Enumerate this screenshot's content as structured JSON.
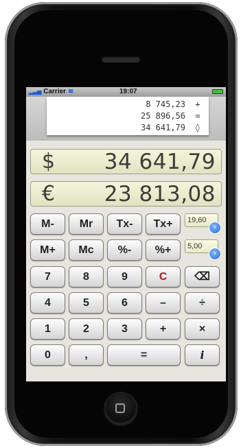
{
  "status": {
    "carrier": "Carrier",
    "time": "19:07"
  },
  "tape": [
    {
      "value": "8 745,23",
      "op": "+"
    },
    {
      "value": "25 896,56",
      "op": "="
    },
    {
      "value": "34 641,79",
      "op": "◊"
    }
  ],
  "display": {
    "dollar": {
      "symbol": "$",
      "value": "34 641,79"
    },
    "euro": {
      "symbol": "€",
      "value": "23 813,08"
    }
  },
  "keys": {
    "m_minus": "M-",
    "mr": "Mr",
    "tx_minus": "Tx-",
    "tx_plus": "Tx+",
    "m_plus": "M+",
    "mc": "Mc",
    "pct_minus": "%-",
    "pct_plus": "%+",
    "seven": "7",
    "eight": "8",
    "nine": "9",
    "clear": "C",
    "backspace": "⌫",
    "four": "4",
    "five": "5",
    "six": "6",
    "minus": "–",
    "divide": "÷",
    "one": "1",
    "two": "2",
    "three": "3",
    "plus": "+",
    "multiply": "×",
    "zero": "0",
    "comma": ",",
    "equals": "=",
    "info": "i"
  },
  "rates": {
    "tax": "19,60",
    "percent": "5,00"
  },
  "colors": {
    "clear_key": "#b01e1e",
    "lcd": "#e8ebcc",
    "rate_button": "#2e6fd4"
  }
}
